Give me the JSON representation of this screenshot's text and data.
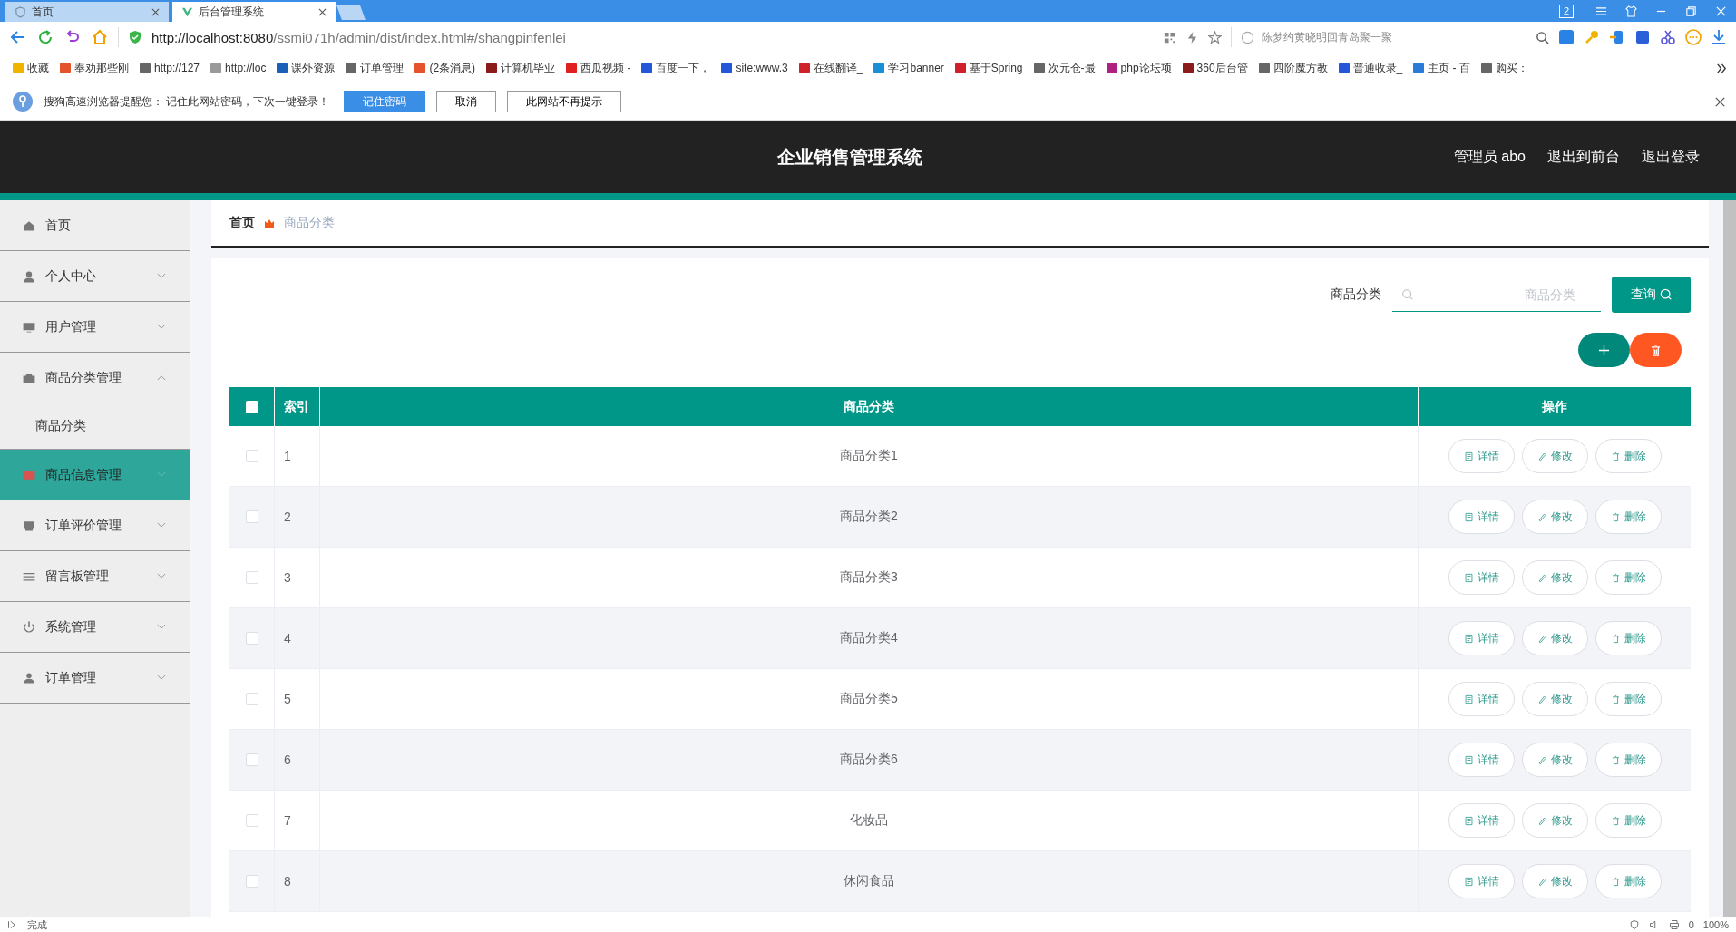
{
  "browser": {
    "tabs": [
      {
        "title": "首页",
        "selected": false
      },
      {
        "title": "后台管理系统",
        "selected": true
      }
    ],
    "window_badge": "2",
    "address": {
      "host": "http://localhost:8080",
      "path": "/ssmi071h/admin/dist/index.html#/shangpinfenlei"
    },
    "search": {
      "value": "陈梦约黄晓明回青岛聚一聚"
    },
    "bookmarks": [
      "收藏",
      "奉劝那些刚",
      "http://127",
      "http://loc",
      "课外资源",
      "订单管理",
      "(2条消息)",
      "计算机毕业",
      "西瓜视频 -",
      "百度一下，",
      "site:www.3",
      "在线翻译_",
      "学习banner",
      "基于Spring",
      "次元仓-最",
      "php论坛项",
      "360后台管",
      "四阶魔方教",
      "普通收录_",
      "主页 - 百",
      "购买："
    ],
    "notice": {
      "text": "搜狗高速浏览器提醒您： 记住此网站密码，下次一键登录！",
      "buttons": [
        "记住密码",
        "取消",
        "此网站不再提示"
      ]
    },
    "status": {
      "text": "完成",
      "count": "0",
      "zoom": "100%"
    }
  },
  "app": {
    "title": "企业销售管理系统",
    "user_links": [
      "管理员 abo",
      "退出到前台",
      "退出登录"
    ],
    "sidebar": [
      {
        "label": "首页",
        "selected": false
      },
      {
        "label": "个人中心",
        "expanded": false,
        "selected": false
      },
      {
        "label": "用户管理",
        "expanded": false,
        "selected": false
      },
      {
        "label": "商品分类管理",
        "expanded": true,
        "selected": false,
        "children": [
          {
            "label": "商品分类",
            "selected": false
          }
        ]
      },
      {
        "label": "商品信息管理",
        "expanded": false,
        "selected": true
      },
      {
        "label": "订单评价管理",
        "expanded": false,
        "selected": false
      },
      {
        "label": "留言板管理",
        "expanded": false,
        "selected": false
      },
      {
        "label": "系统管理",
        "expanded": false,
        "selected": false
      },
      {
        "label": "订单管理",
        "expanded": false,
        "selected": false
      }
    ],
    "breadcrumb": [
      "首页",
      "商品分类"
    ],
    "filter": {
      "label": "商品分类",
      "placeholder": "商品分类",
      "button": "查询"
    },
    "table": {
      "select_all_checked": false,
      "columns": [
        "索引",
        "商品分类",
        "操作"
      ],
      "rows": [
        {
          "checked": false,
          "index": "1",
          "name": "商品分类1",
          "actions": [
            "详情",
            "修改",
            "删除"
          ]
        },
        {
          "checked": false,
          "index": "2",
          "name": "商品分类2",
          "actions": [
            "详情",
            "修改",
            "删除"
          ]
        },
        {
          "checked": false,
          "index": "3",
          "name": "商品分类3",
          "actions": [
            "详情",
            "修改",
            "删除"
          ]
        },
        {
          "checked": false,
          "index": "4",
          "name": "商品分类4",
          "actions": [
            "详情",
            "修改",
            "删除"
          ]
        },
        {
          "checked": false,
          "index": "5",
          "name": "商品分类5",
          "actions": [
            "详情",
            "修改",
            "删除"
          ]
        },
        {
          "checked": false,
          "index": "6",
          "name": "商品分类6",
          "actions": [
            "详情",
            "修改",
            "删除"
          ]
        },
        {
          "checked": false,
          "index": "7",
          "name": "化妆品",
          "actions": [
            "详情",
            "修改",
            "删除"
          ]
        },
        {
          "checked": false,
          "index": "8",
          "name": "休闲食品",
          "actions": [
            "详情",
            "修改",
            "删除"
          ]
        }
      ]
    }
  }
}
